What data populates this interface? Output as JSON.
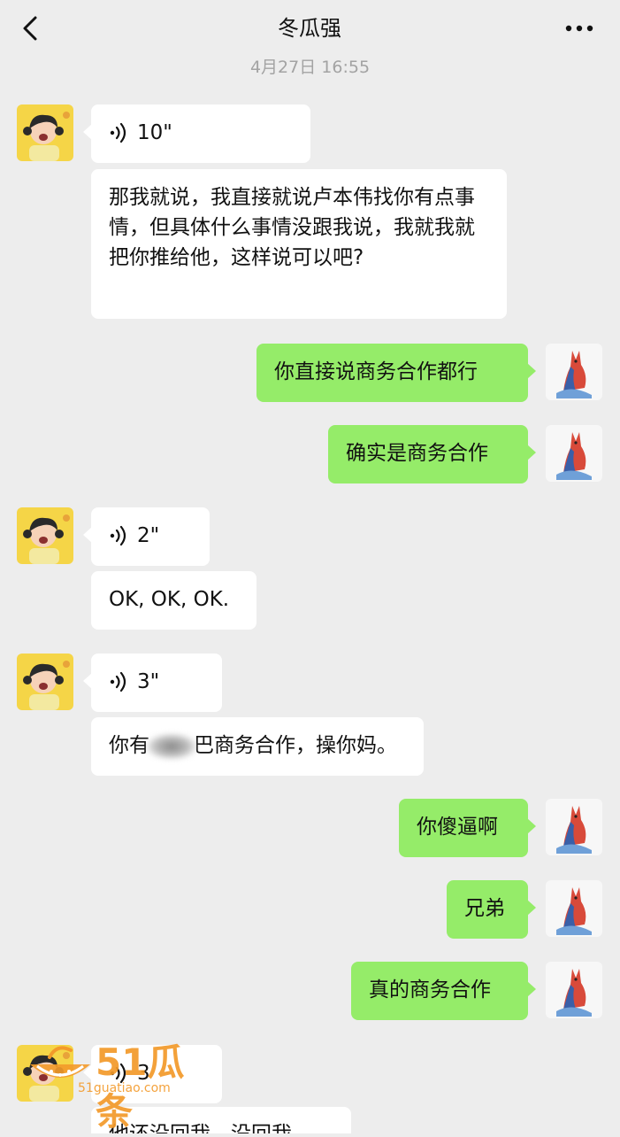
{
  "header": {
    "title": "冬瓜强",
    "back_icon": "chevron-left-icon",
    "more_icon": "more-horizontal-icon"
  },
  "timestamp": "4月27日 16:55",
  "messages": [
    {
      "side": "in",
      "type": "voice",
      "duration": "10\""
    },
    {
      "side": "in",
      "type": "text",
      "text": "那我就说，我直接就说卢本伟找你有点事情，但具体什么事情没跟我说，我就我就把你推给他，这样说可以吧?"
    },
    {
      "side": "out",
      "type": "text",
      "text": "你直接说商务合作都行"
    },
    {
      "side": "out",
      "type": "text",
      "text": "确实是商务合作"
    },
    {
      "side": "in",
      "type": "voice",
      "duration": "2\""
    },
    {
      "side": "in",
      "type": "text",
      "text": "OK, OK, OK."
    },
    {
      "side": "in",
      "type": "voice",
      "duration": "3\""
    },
    {
      "side": "in",
      "type": "text",
      "text_before_blur": "你有",
      "text_after_blur": "巴商务合作，操你妈。"
    },
    {
      "side": "out",
      "type": "text",
      "text": "你傻逼啊"
    },
    {
      "side": "out",
      "type": "text",
      "text": "兄弟"
    },
    {
      "side": "out",
      "type": "text",
      "text": "真的商务合作"
    },
    {
      "side": "in",
      "type": "voice",
      "duration": "3"
    },
    {
      "side": "in",
      "type": "text",
      "text": "他还没回我，没回我"
    }
  ],
  "watermark": {
    "brand": "51瓜条",
    "url": "51guatiao.com"
  },
  "colors": {
    "background": "#ededed",
    "incoming_bubble": "#ffffff",
    "outgoing_bubble": "#95ec69",
    "timestamp_text": "#a3a3a3",
    "watermark": "#f39a2a"
  }
}
